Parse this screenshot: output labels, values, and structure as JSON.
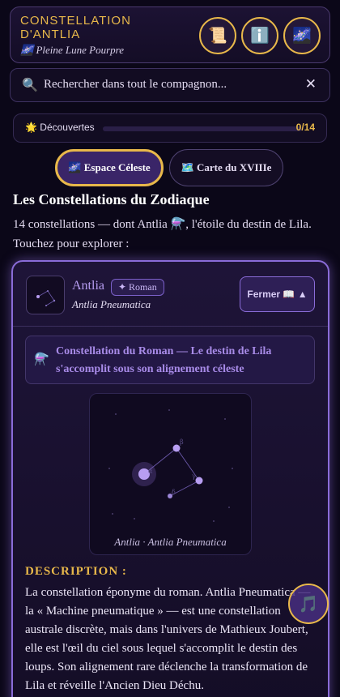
{
  "header": {
    "title": "Constellation d'Antlia",
    "subtitle_icon": "🌌",
    "subtitle": "Pleine Lune Pourpre",
    "buttons": [
      {
        "icon": "📜",
        "name": "scroll-icon"
      },
      {
        "icon": "ℹ️",
        "name": "info-icon"
      },
      {
        "icon": "🌌",
        "name": "galaxy-icon"
      }
    ]
  },
  "search": {
    "icon": "🔍",
    "placeholder": "Rechercher dans tout le compagnon...",
    "clear_icon": "✕"
  },
  "progress": {
    "icon": "🌟",
    "label": "Découvertes",
    "discovered": 0,
    "total": 14,
    "count_text": "0/14"
  },
  "tabs": [
    {
      "icon": "🌌",
      "label": "Espace Céleste",
      "active": true
    },
    {
      "icon": "🗺️",
      "label": "Carte du XVIIIe",
      "active": false
    }
  ],
  "section": {
    "title": "Les Constellations du Zodiaque",
    "description": "14 constellations — dont Antlia ⚗️, l'étoile du destin de Lila. Touchez pour explorer :"
  },
  "card": {
    "name": "Antlia",
    "tag": "✦ Roman",
    "latin": "Antlia Pneumatica",
    "close_label": "Fermer 📖 ▲",
    "note_icon": "⚗️",
    "note": "Constellation du Roman — Le destin de Lila s'accomplit sous son alignement céleste",
    "sky_caption": "Antlia · Antlia Pneumatica",
    "star_labels": [
      "α",
      "β",
      "γ",
      "δ"
    ],
    "description_heading": "DESCRIPTION :",
    "description": "La constellation éponyme du roman. Antlia Pneumatica — la « Machine pneumatique » — est une constellation australe discrète, mais dans l'univers de Mathieux Joubert, elle est l'œil du ciel sous lequel s'accomplit le destin des loups. Son alignement rare déclenche la transformation de Lila et réveille l'Ancien Dieu Déchu."
  },
  "music_button": {
    "icon": "🎵"
  },
  "colors": {
    "background": "#0b0718",
    "accent_gold": "#e8b84a",
    "accent_violet": "#8a6cd8"
  }
}
